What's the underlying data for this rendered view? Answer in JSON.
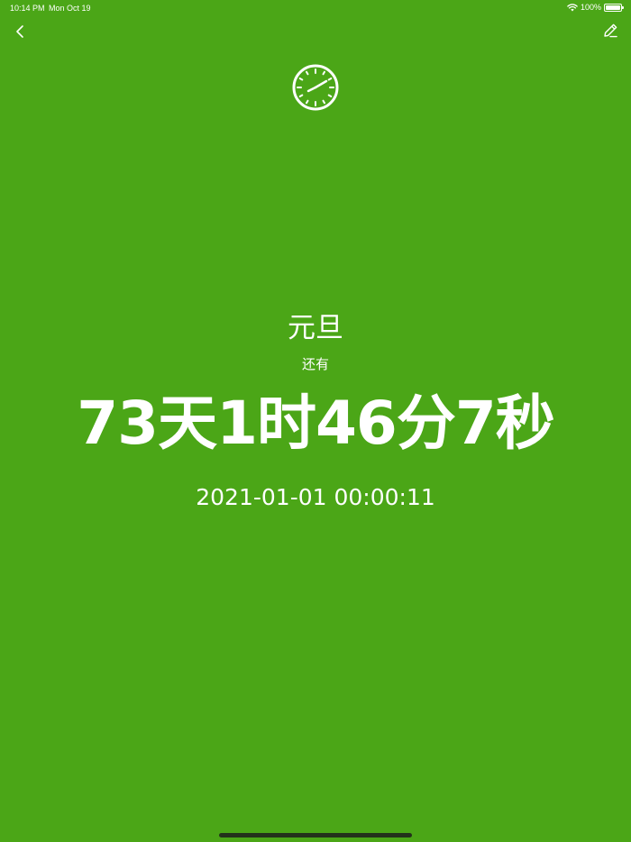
{
  "status_bar": {
    "time": "10:14 PM",
    "date": "Mon Oct 19",
    "battery": "100%",
    "icons": [
      "wifi-icon",
      "battery-icon"
    ]
  },
  "nav": {
    "back_icon": "chevron-left-icon",
    "edit_icon": "pencil-icon"
  },
  "header_icon": "clock-icon",
  "event": {
    "title": "元旦",
    "remaining_label": "还有",
    "countdown": "73天1时46分7秒",
    "target_datetime": "2021-01-01 00:00:11"
  },
  "colors": {
    "background": "#4ba617",
    "foreground": "#ffffff"
  }
}
